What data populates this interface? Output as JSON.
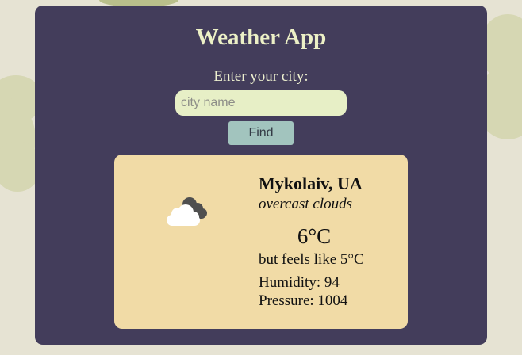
{
  "app": {
    "title": "Weather App"
  },
  "search": {
    "label": "Enter your city:",
    "value": "",
    "placeholder": "city name",
    "button_label": "Find"
  },
  "weather": {
    "location": "Mykolaiv, UA",
    "description": "overcast clouds",
    "temperature": "6°C",
    "feels_like": "but feels like 5°C",
    "humidity": "Humidity: 94",
    "pressure": "Pressure: 1004",
    "icon": "overcast-clouds-icon"
  },
  "colors": {
    "page_background": "#e6e3d3",
    "panel_background": "#433d5b",
    "title_color": "#ecf0c6",
    "input_background": "#e7efc6",
    "button_background": "#a2c4be",
    "card_background": "#f1dba6"
  }
}
